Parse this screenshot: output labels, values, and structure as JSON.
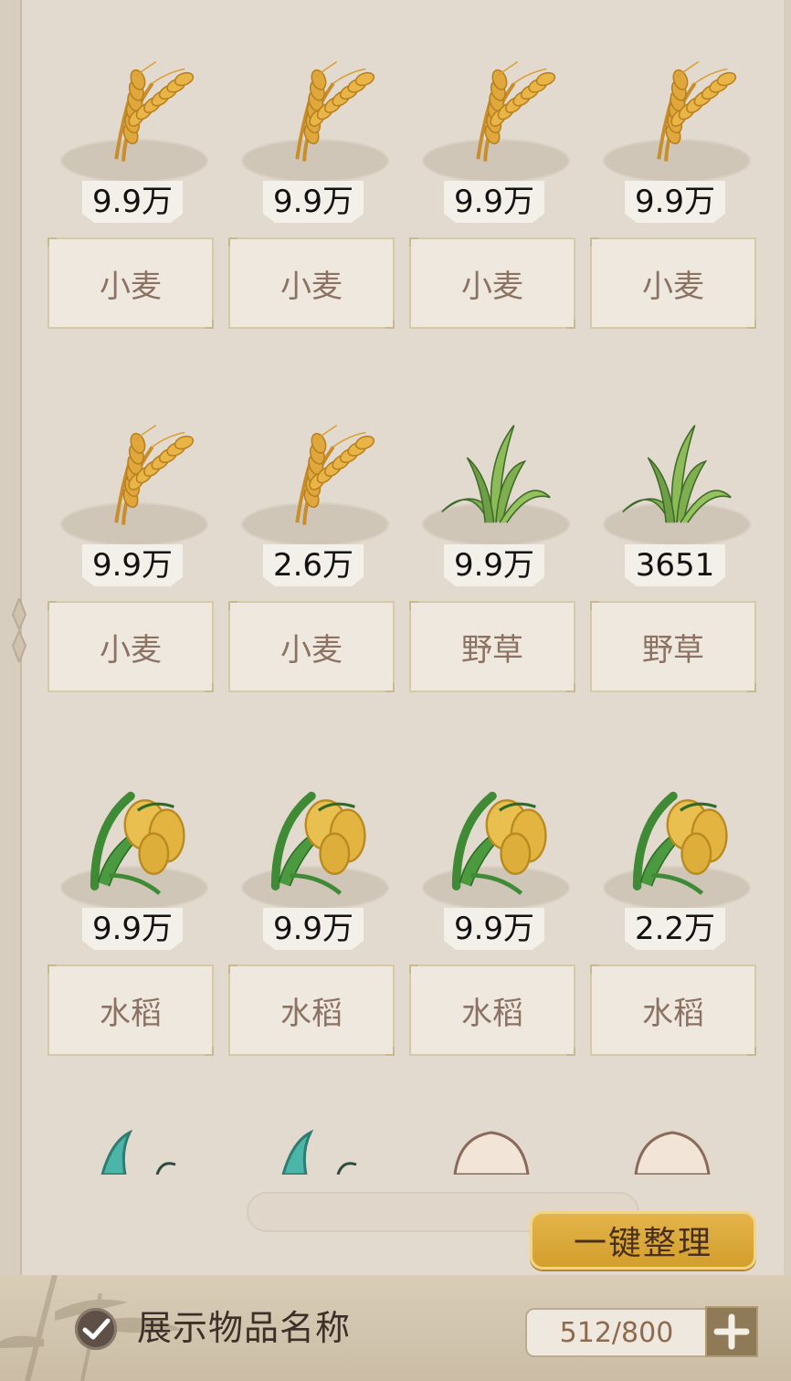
{
  "inventory": {
    "items": [
      {
        "type": "wheat",
        "count": "9.9万",
        "name": "小麦"
      },
      {
        "type": "wheat",
        "count": "9.9万",
        "name": "小麦"
      },
      {
        "type": "wheat",
        "count": "9.9万",
        "name": "小麦"
      },
      {
        "type": "wheat",
        "count": "9.9万",
        "name": "小麦"
      },
      {
        "type": "wheat",
        "count": "9.9万",
        "name": "小麦"
      },
      {
        "type": "wheat",
        "count": "2.6万",
        "name": "小麦"
      },
      {
        "type": "grass",
        "count": "9.9万",
        "name": "野草"
      },
      {
        "type": "grass",
        "count": "3651",
        "name": "野草"
      },
      {
        "type": "rice",
        "count": "9.9万",
        "name": "水稻"
      },
      {
        "type": "rice",
        "count": "9.9万",
        "name": "水稻"
      },
      {
        "type": "rice",
        "count": "9.9万",
        "name": "水稻"
      },
      {
        "type": "rice",
        "count": "2.2万",
        "name": "水稻"
      }
    ],
    "partial_row_types": [
      "teal-leaf",
      "teal-leaf",
      "egg",
      "egg"
    ]
  },
  "actions": {
    "sort_label": "一键整理"
  },
  "footer": {
    "show_names_label": "展示物品名称",
    "show_names_checked": true,
    "capacity": "512/800"
  },
  "colors": {
    "accent_gold": "#d9a838",
    "name_text": "#8b7262",
    "panel_bg": "#e2dace"
  }
}
